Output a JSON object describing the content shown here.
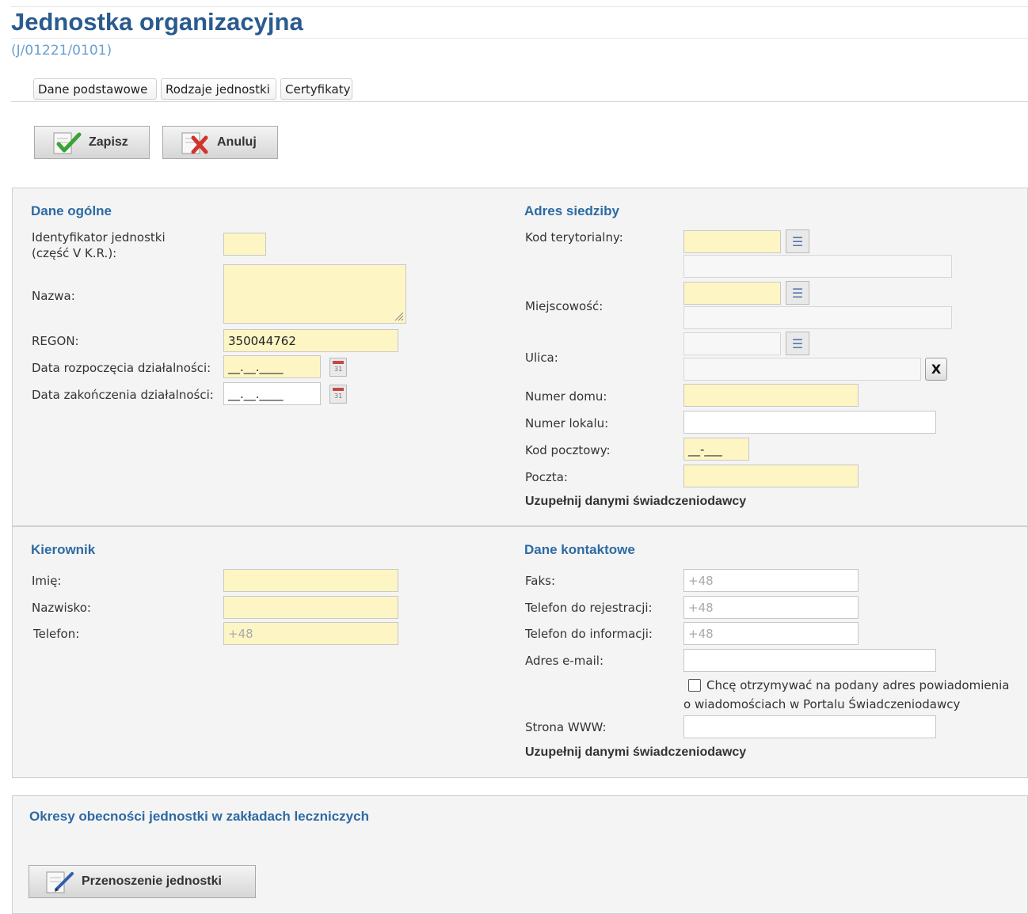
{
  "page": {
    "title": "Jednostka organizacyjna",
    "subtitle": "(J/01221/0101)"
  },
  "tabs": [
    "Dane podstawowe",
    "Rodzaje jednostki",
    "Certyfikaty"
  ],
  "toolbar": {
    "save_label": "Zapisz",
    "cancel_label": "Anuluj"
  },
  "dane_ogolne": {
    "heading": "Dane ogólne",
    "identyfikator_label_1": "Identyfikator jednostki",
    "identyfikator_label_2": "(część V K.R.):",
    "identyfikator_value": "",
    "nazwa_label": "Nazwa:",
    "nazwa_value": "",
    "regon_label": "REGON:",
    "regon_value": "350044762",
    "data_rozp_label": "Data rozpoczęcia działalności:",
    "data_rozp_value": "__.__.____",
    "data_zak_label": "Data zakończenia działalności:",
    "data_zak_value": "__.__.____"
  },
  "adres": {
    "heading": "Adres siedziby",
    "kod_terytorialny_label": "Kod terytorialny:",
    "miejscowosc_label": "Miejscowość:",
    "ulica_label": "Ulica:",
    "ulica_clear": "X",
    "numer_domu_label": "Numer domu:",
    "numer_lokalu_label": "Numer lokalu:",
    "kod_pocztowy_label": "Kod pocztowy:",
    "kod_pocztowy_value": "__-___",
    "poczta_label": "Poczta:",
    "fill_link": "Uzupełnij danymi świadczeniodawcy"
  },
  "kierownik": {
    "heading": "Kierownik",
    "imie_label": "Imię:",
    "nazwisko_label": "Nazwisko:",
    "telefon_label": "Telefon:",
    "telefon_placeholder": "+48"
  },
  "kontakt": {
    "heading": "Dane kontaktowe",
    "faks_label": "Faks:",
    "faks_placeholder": "+48",
    "tel_rej_label": "Telefon do rejestracji:",
    "tel_rej_placeholder": "+48",
    "tel_inf_label": "Telefon do informacji:",
    "tel_inf_placeholder": "+48",
    "email_label": "Adres e-mail:",
    "notify_line1": "Chcę otrzymywać na podany adres powiadomienia",
    "notify_line2": "o wiadomościach w Portalu Świadczeniodawcy",
    "www_label": "Strona WWW:",
    "fill_link": "Uzupełnij danymi świadczeniodawcy"
  },
  "okresy": {
    "heading": "Okresy obecności jednostki w zakładach leczniczych",
    "move_button": "Przenoszenie jednostki"
  }
}
